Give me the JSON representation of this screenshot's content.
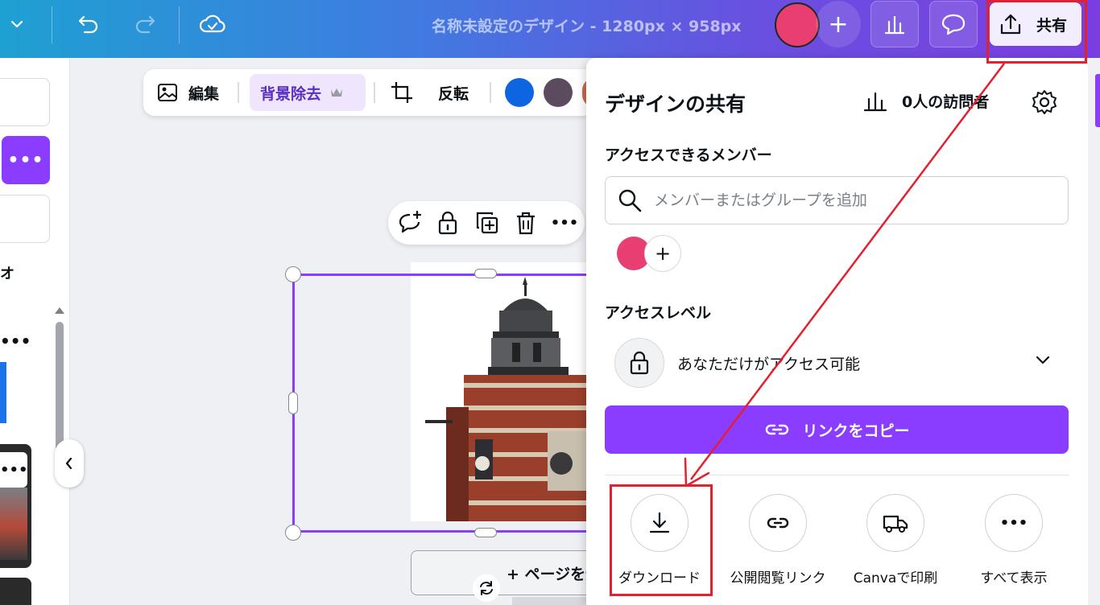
{
  "topbar": {
    "title": "名称未設定のデザイン - 1280px × 958px",
    "share_label": "共有"
  },
  "image_toolbar": {
    "edit_label": "編集",
    "bg_remove_label": "背景除去",
    "flip_label": "反転",
    "swatches": [
      "#0d66e0",
      "#5c4a5e",
      "#c96a4a"
    ]
  },
  "canvas": {
    "add_page_label": "+ ページを追加"
  },
  "sidebar": {
    "partial_text": "オ"
  },
  "share_panel": {
    "title": "デザインの共有",
    "visitors_label": "0人の訪問者",
    "members_label": "アクセスできるメンバー",
    "member_search_placeholder": "メンバーまたはグループを追加",
    "access_level_label": "アクセスレベル",
    "access_level_value": "あなただけがアクセス可能",
    "copy_link_label": "リンクをコピー",
    "options": [
      {
        "label": "ダウンロード",
        "icon": "download-icon"
      },
      {
        "label": "公開閲覧リンク",
        "icon": "link-icon"
      },
      {
        "label": "Canvaで印刷",
        "icon": "truck-icon"
      },
      {
        "label": "すべて表示",
        "icon": "more-icon"
      }
    ]
  },
  "colors": {
    "accent": "#8b3dff",
    "annotation": "#e4202f",
    "avatar": "#e83e72"
  }
}
